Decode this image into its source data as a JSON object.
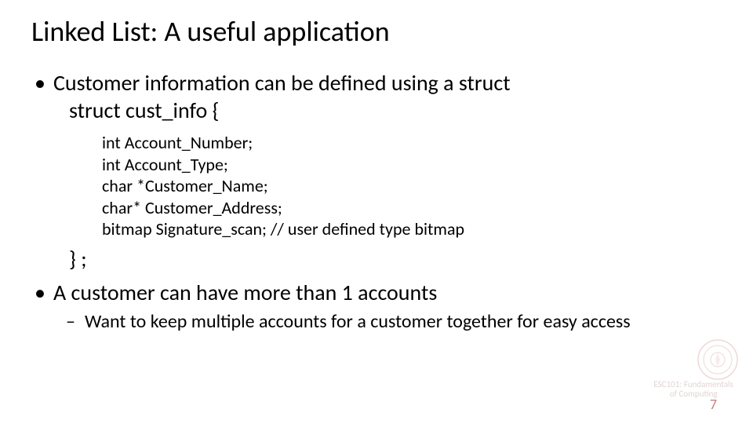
{
  "title": "Linked List: A useful application",
  "bullets": [
    {
      "text": "Customer information can be defined using a struct",
      "struct_decl": "struct cust_info {",
      "code": [
        "int Account_Number;",
        "int Account_Type;",
        "char *Customer_Name;",
        "char* Customer_Address;",
        "bitmap Signature_scan; // user defined type bitmap"
      ],
      "struct_close": "} ;"
    },
    {
      "text": "A customer can have more than 1 accounts",
      "sub": [
        "Want to keep multiple accounts for a customer together for easy access"
      ]
    }
  ],
  "footer": {
    "line1": "ESC101: Fundamentals",
    "line2": "of Computing"
  },
  "page_number": "7"
}
